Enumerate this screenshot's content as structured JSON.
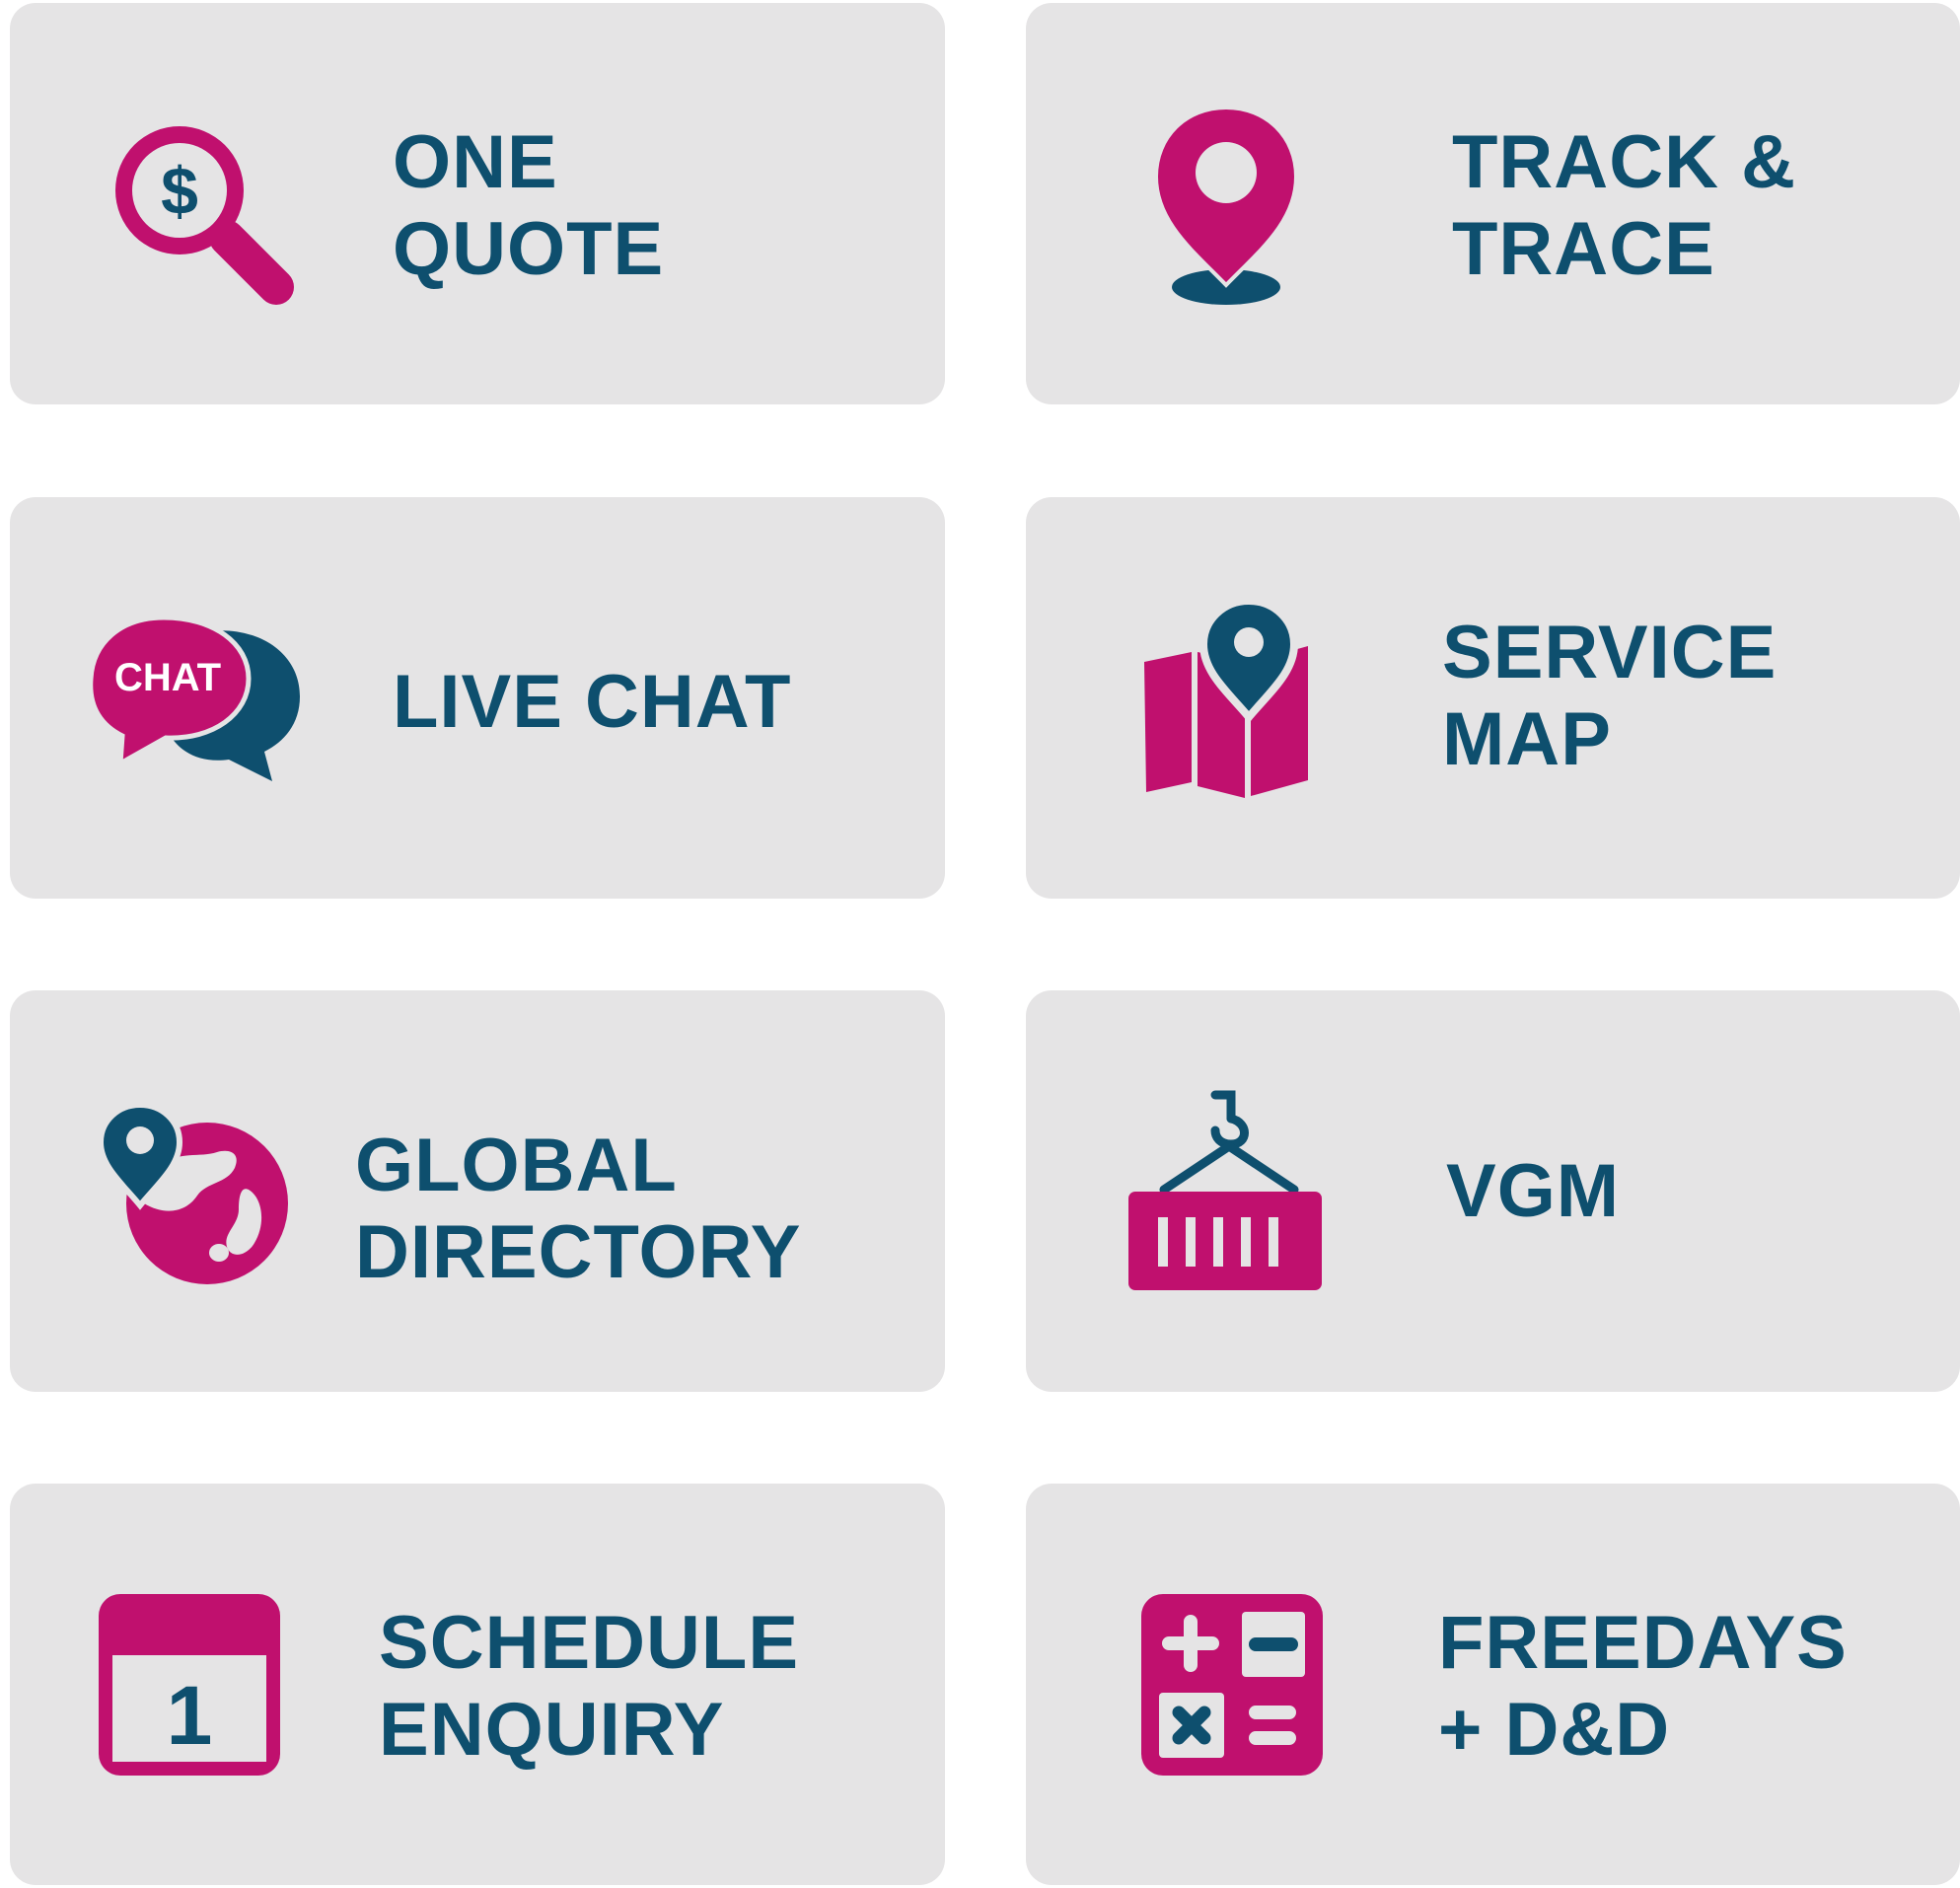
{
  "colors": {
    "tile_background": "#e5e4e5",
    "label_text": "#0e4f6e",
    "icon_primary": "#c0106e",
    "icon_secondary": "#0e4f6e"
  },
  "tiles": [
    {
      "id": "one-quote",
      "icon": "dollar-search-icon",
      "label_lines": [
        "ONE",
        "QUOTE"
      ]
    },
    {
      "id": "track-trace",
      "icon": "location-pin-icon",
      "label_lines": [
        "TRACK &",
        "TRACE"
      ]
    },
    {
      "id": "live-chat",
      "icon": "chat-bubbles-icon",
      "icon_text": "CHAT",
      "label_lines": [
        "LIVE CHAT"
      ]
    },
    {
      "id": "service-map",
      "icon": "folded-map-icon",
      "label_lines": [
        "SERVICE",
        "MAP"
      ]
    },
    {
      "id": "global-directory",
      "icon": "globe-pin-icon",
      "label_lines": [
        "GLOBAL",
        "DIRECTORY"
      ]
    },
    {
      "id": "vgm",
      "icon": "container-hook-icon",
      "label_lines": [
        "VGM"
      ]
    },
    {
      "id": "schedule-enquiry",
      "icon": "calendar-icon",
      "icon_text": "1",
      "label_lines": [
        "SCHEDULE",
        "ENQUIRY"
      ]
    },
    {
      "id": "freedays-dd",
      "icon": "calculator-icon",
      "label_lines": [
        "FREEDAYS",
        "+ D&D"
      ]
    }
  ]
}
